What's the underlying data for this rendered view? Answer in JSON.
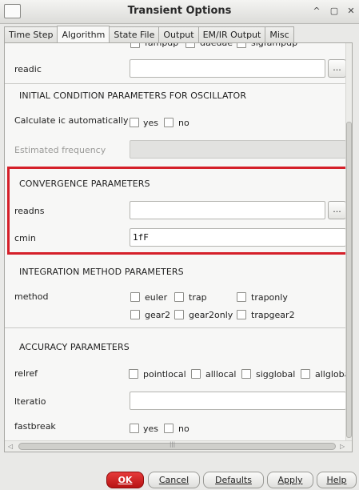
{
  "window": {
    "title": "Transient Options",
    "controls": [
      "^",
      "▢",
      "✕"
    ]
  },
  "tabs": [
    {
      "label": "Time Step"
    },
    {
      "label": "Algorithm"
    },
    {
      "label": "State File"
    },
    {
      "label": "Output"
    },
    {
      "label": "EM/IR Output"
    },
    {
      "label": "Misc"
    }
  ],
  "active_tab": "Algorithm",
  "top_partial_options": [
    "fampdp",
    "daedae",
    "sigfampdp"
  ],
  "readic": {
    "label": "readic",
    "value": "",
    "browse_label": "..."
  },
  "oscillator": {
    "section_title": "INITIAL CONDITION PARAMETERS FOR OSCILLATOR",
    "calc_label": "Calculate ic automatically",
    "yes_label": "yes",
    "no_label": "no",
    "freq_label": "Estimated frequency",
    "freq_value": ""
  },
  "convergence": {
    "section_title": "CONVERGENCE PARAMETERS",
    "readns_label": "readns",
    "readns_value": "",
    "browse_label": "...",
    "cmin_label": "cmin",
    "cmin_value": "1fF"
  },
  "integration": {
    "section_title": "INTEGRATION METHOD PARAMETERS",
    "method_label": "method",
    "options": [
      "euler",
      "trap",
      "traponly",
      "gear2",
      "gear2only",
      "trapgear2"
    ]
  },
  "accuracy": {
    "section_title": "ACCURACY PARAMETERS",
    "relref_label": "relref",
    "relref_options": [
      "pointlocal",
      "alllocal",
      "sigglobal",
      "allglobal"
    ],
    "lteratio_label": "lteratio",
    "lteratio_value": "",
    "fastbreak_label": "fastbreak",
    "yes_label": "yes",
    "no_label": "no"
  },
  "hscroll": {
    "left_arrow": "◁",
    "right_arrow": "▷",
    "grip": "|||"
  },
  "buttons": {
    "ok": "OK",
    "cancel": "Cancel",
    "defaults": "Defaults",
    "apply": "Apply",
    "help": "Help"
  },
  "colors": {
    "highlight": "#d5202a",
    "ok_button": "#c81e1e"
  }
}
